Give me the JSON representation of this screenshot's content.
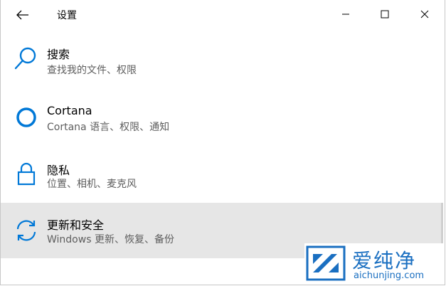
{
  "window": {
    "title": "设置"
  },
  "items": [
    {
      "label": "搜索",
      "sub": "查找我的文件、权限",
      "icon": "search-icon"
    },
    {
      "label": "Cortana",
      "sub": "Cortana 语言、权限、通知",
      "icon": "cortana-icon"
    },
    {
      "label": "隐私",
      "sub": "位置、相机、麦克风",
      "icon": "lock-icon"
    },
    {
      "label": "更新和安全",
      "sub": "Windows 更新、恢复、备份",
      "icon": "sync-icon"
    }
  ],
  "watermark": {
    "brand": "爱纯净",
    "url": "aichunjing.com"
  },
  "colors": {
    "accent": "#0078d7",
    "highlight": "#e6e6e6",
    "watermark": "#1a6fc1"
  }
}
